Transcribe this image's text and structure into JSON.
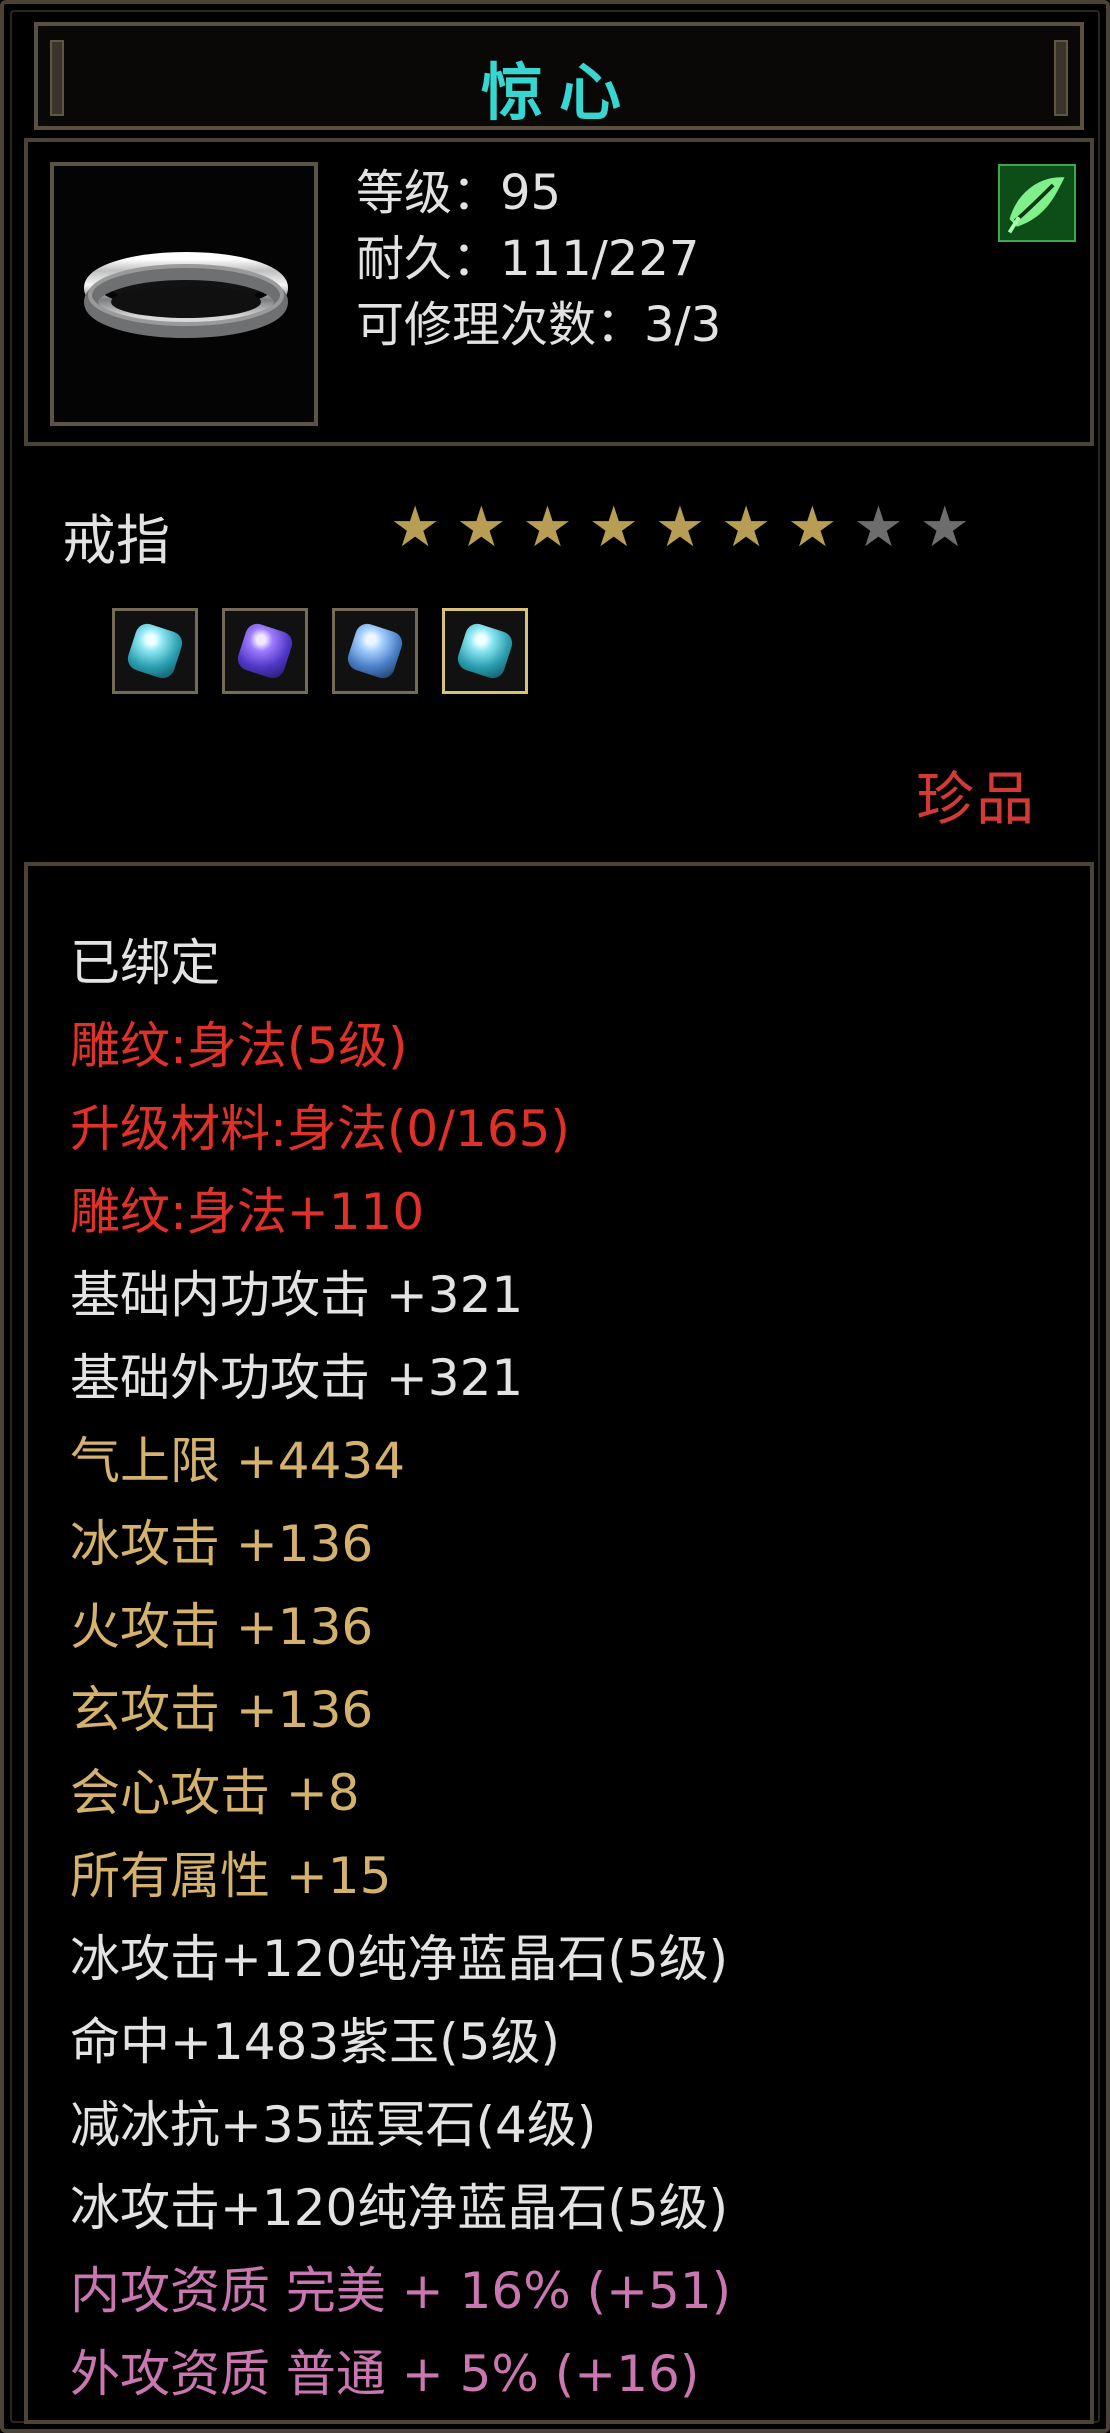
{
  "window": {
    "title": "惊心"
  },
  "item": {
    "level": "等级：95",
    "durability": "耐久：111/227",
    "repair": "可修理次数：3/3",
    "type": "戒指",
    "rarity": "珍品",
    "stars_total": 9,
    "stars_filled": 7
  },
  "gems": [
    {
      "name": "cyan-gem",
      "selected": false
    },
    {
      "name": "purple-gem",
      "selected": false
    },
    {
      "name": "blue-gem",
      "selected": false
    },
    {
      "name": "cyan-gem",
      "selected": true
    }
  ],
  "attributes": [
    {
      "text": "已绑定",
      "color": "white"
    },
    {
      "text": "雕纹:身法(5级)",
      "color": "red"
    },
    {
      "text": "升级材料:身法(0/165)",
      "color": "red"
    },
    {
      "text": "雕纹:身法+110",
      "color": "red"
    },
    {
      "text": "基础内功攻击  +321",
      "color": "white"
    },
    {
      "text": "基础外功攻击  +321",
      "color": "white"
    },
    {
      "text": "气上限  +4434",
      "color": "gold"
    },
    {
      "text": "冰攻击  +136",
      "color": "gold"
    },
    {
      "text": "火攻击  +136",
      "color": "gold"
    },
    {
      "text": "玄攻击  +136",
      "color": "gold"
    },
    {
      "text": "会心攻击  +8",
      "color": "gold"
    },
    {
      "text": "所有属性  +15",
      "color": "gold"
    },
    {
      "text": "冰攻击+120纯净蓝晶石(5级)",
      "color": "white"
    },
    {
      "text": "命中+1483紫玉(5级)",
      "color": "white"
    },
    {
      "text": "减冰抗+35蓝冥石(4级)",
      "color": "white"
    },
    {
      "text": "冰攻击+120纯净蓝晶石(5级)",
      "color": "white"
    },
    {
      "text": "内攻资质  完美  + 16% (+51)",
      "color": "pink"
    },
    {
      "text": "外攻资质  普通  + 5% (+16)",
      "color": "pink"
    }
  ]
}
